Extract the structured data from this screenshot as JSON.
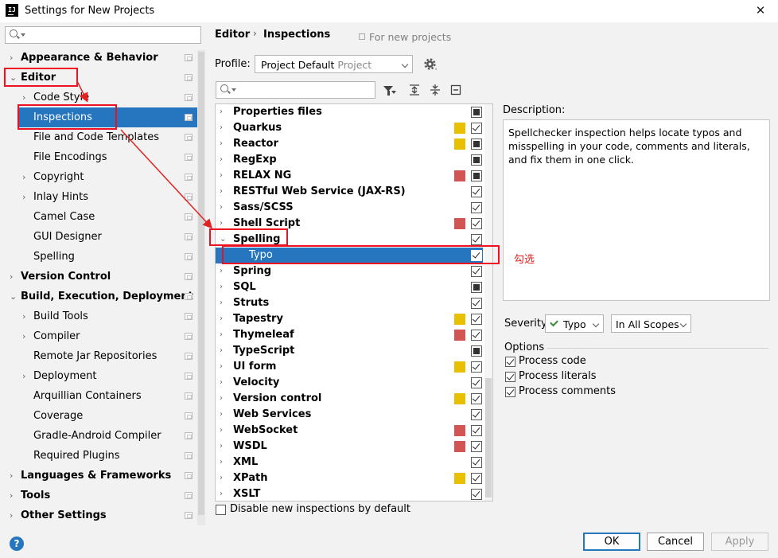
{
  "window": {
    "title": "Settings for New Projects",
    "app_icon": "IJ"
  },
  "sidebar": {
    "items": [
      {
        "label": "Appearance & Behavior",
        "level": 0,
        "bold": true,
        "arrow": "›"
      },
      {
        "label": "Editor",
        "level": 0,
        "bold": true,
        "arrow": "⌄",
        "boxed": true
      },
      {
        "label": "Code Style",
        "level": 1,
        "arrow": "›"
      },
      {
        "label": "Inspections",
        "level": 1,
        "selected": true,
        "boxed": true
      },
      {
        "label": "File and Code Templates",
        "level": 1
      },
      {
        "label": "File Encodings",
        "level": 1
      },
      {
        "label": "Copyright",
        "level": 1,
        "arrow": "›"
      },
      {
        "label": "Inlay Hints",
        "level": 1,
        "arrow": "›"
      },
      {
        "label": "Camel Case",
        "level": 1
      },
      {
        "label": "GUI Designer",
        "level": 1
      },
      {
        "label": "Spelling",
        "level": 1
      },
      {
        "label": "Version Control",
        "level": 0,
        "bold": true,
        "arrow": "›"
      },
      {
        "label": "Build, Execution, Deployment",
        "level": 0,
        "bold": true,
        "arrow": "⌄"
      },
      {
        "label": "Build Tools",
        "level": 1,
        "arrow": "›"
      },
      {
        "label": "Compiler",
        "level": 1,
        "arrow": "›"
      },
      {
        "label": "Remote Jar Repositories",
        "level": 1
      },
      {
        "label": "Deployment",
        "level": 1,
        "arrow": "›"
      },
      {
        "label": "Arquillian Containers",
        "level": 1
      },
      {
        "label": "Coverage",
        "level": 1
      },
      {
        "label": "Gradle-Android Compiler",
        "level": 1
      },
      {
        "label": "Required Plugins",
        "level": 1
      },
      {
        "label": "Languages & Frameworks",
        "level": 0,
        "bold": true,
        "arrow": "›"
      },
      {
        "label": "Tools",
        "level": 0,
        "bold": true,
        "arrow": "›"
      },
      {
        "label": "Other Settings",
        "level": 0,
        "bold": true,
        "arrow": "›"
      }
    ]
  },
  "header": {
    "breadcrumb_1": "Editor",
    "separator": "›",
    "breadcrumb_2": "Inspections",
    "scope_note": "For new projects"
  },
  "profile": {
    "label": "Profile:",
    "value": "Project Default",
    "value_suffix": "Project"
  },
  "inspections": [
    {
      "label": "Properties files",
      "severity_color": "",
      "state": "partial"
    },
    {
      "label": "Quarkus",
      "severity_color": "#e8c000",
      "state": "checked"
    },
    {
      "label": "Reactor",
      "severity_color": "#e8c000",
      "state": "partial"
    },
    {
      "label": "RegExp",
      "severity_color": "",
      "state": "partial"
    },
    {
      "label": "RELAX NG",
      "severity_color": "#d35454",
      "state": "partial"
    },
    {
      "label": "RESTful Web Service (JAX-RS)",
      "severity_color": "",
      "state": "checked"
    },
    {
      "label": "Sass/SCSS",
      "severity_color": "",
      "state": "checked"
    },
    {
      "label": "Shell Script",
      "severity_color": "#d35454",
      "state": "checked"
    },
    {
      "label": "Spelling",
      "severity_color": "",
      "state": "checked",
      "expanded": true,
      "boxed": true
    },
    {
      "label": "Typo",
      "severity_color": "",
      "state": "checked",
      "child": true,
      "selected": true,
      "boxed": true
    },
    {
      "label": "Spring",
      "severity_color": "",
      "state": "checked"
    },
    {
      "label": "SQL",
      "severity_color": "",
      "state": "partial"
    },
    {
      "label": "Struts",
      "severity_color": "",
      "state": "checked"
    },
    {
      "label": "Tapestry",
      "severity_color": "#e8c000",
      "state": "checked"
    },
    {
      "label": "Thymeleaf",
      "severity_color": "#d35454",
      "state": "checked"
    },
    {
      "label": "TypeScript",
      "severity_color": "",
      "state": "partial"
    },
    {
      "label": "UI form",
      "severity_color": "#e8c000",
      "state": "checked"
    },
    {
      "label": "Velocity",
      "severity_color": "",
      "state": "checked"
    },
    {
      "label": "Version control",
      "severity_color": "#e8c000",
      "state": "checked"
    },
    {
      "label": "Web Services",
      "severity_color": "",
      "state": "checked"
    },
    {
      "label": "WebSocket",
      "severity_color": "#d35454",
      "state": "checked"
    },
    {
      "label": "WSDL",
      "severity_color": "#d35454",
      "state": "checked"
    },
    {
      "label": "XML",
      "severity_color": "",
      "state": "checked"
    },
    {
      "label": "XPath",
      "severity_color": "#e8c000",
      "state": "checked"
    },
    {
      "label": "XSLT",
      "severity_color": "",
      "state": "checked"
    }
  ],
  "disable_new_label": "Disable new inspections by default",
  "description": {
    "label": "Description:",
    "text": "Spellchecker inspection helps locate typos and misspelling in your code, comments and literals, and fix them in one click."
  },
  "severity": {
    "label": "Severity:",
    "value": "Typo",
    "scope": "In All Scopes"
  },
  "options": {
    "label": "Options",
    "items": [
      {
        "label": "Process code",
        "checked": true
      },
      {
        "label": "Process literals",
        "checked": true
      },
      {
        "label": "Process comments",
        "checked": true
      }
    ]
  },
  "buttons": {
    "ok": "OK",
    "cancel": "Cancel",
    "apply": "Apply",
    "help": "?"
  },
  "annotation": "勾选",
  "colors": {
    "accent": "#2675bf",
    "annotation_red": "#e12222",
    "warning_yellow": "#e8c000",
    "error_red": "#d35454"
  }
}
